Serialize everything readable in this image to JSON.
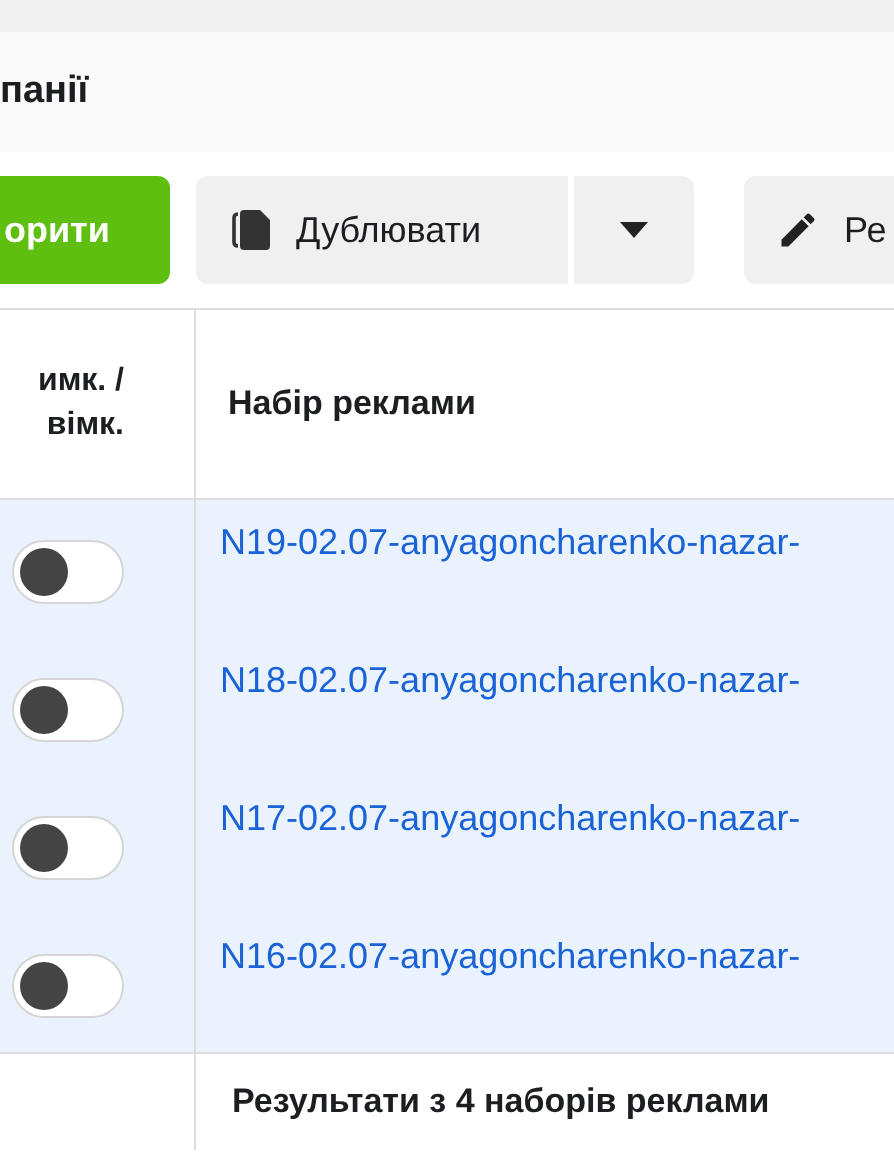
{
  "header": {
    "title": "панії"
  },
  "toolbar": {
    "create_button": "орити",
    "duplicate_button": "Дублювати",
    "edit_button": "Ре"
  },
  "table": {
    "columns": [
      "имк. / вімк.",
      "Набір реклами"
    ],
    "rows": [
      {
        "on": false,
        "name": "N19-02.07-anyagoncharenko-nazar-"
      },
      {
        "on": false,
        "name": "N18-02.07-anyagoncharenko-nazar-"
      },
      {
        "on": false,
        "name": "N17-02.07-anyagoncharenko-nazar-"
      },
      {
        "on": false,
        "name": "N16-02.07-anyagoncharenko-nazar-"
      }
    ],
    "footer": "Результати з 4 наборів реклами"
  }
}
